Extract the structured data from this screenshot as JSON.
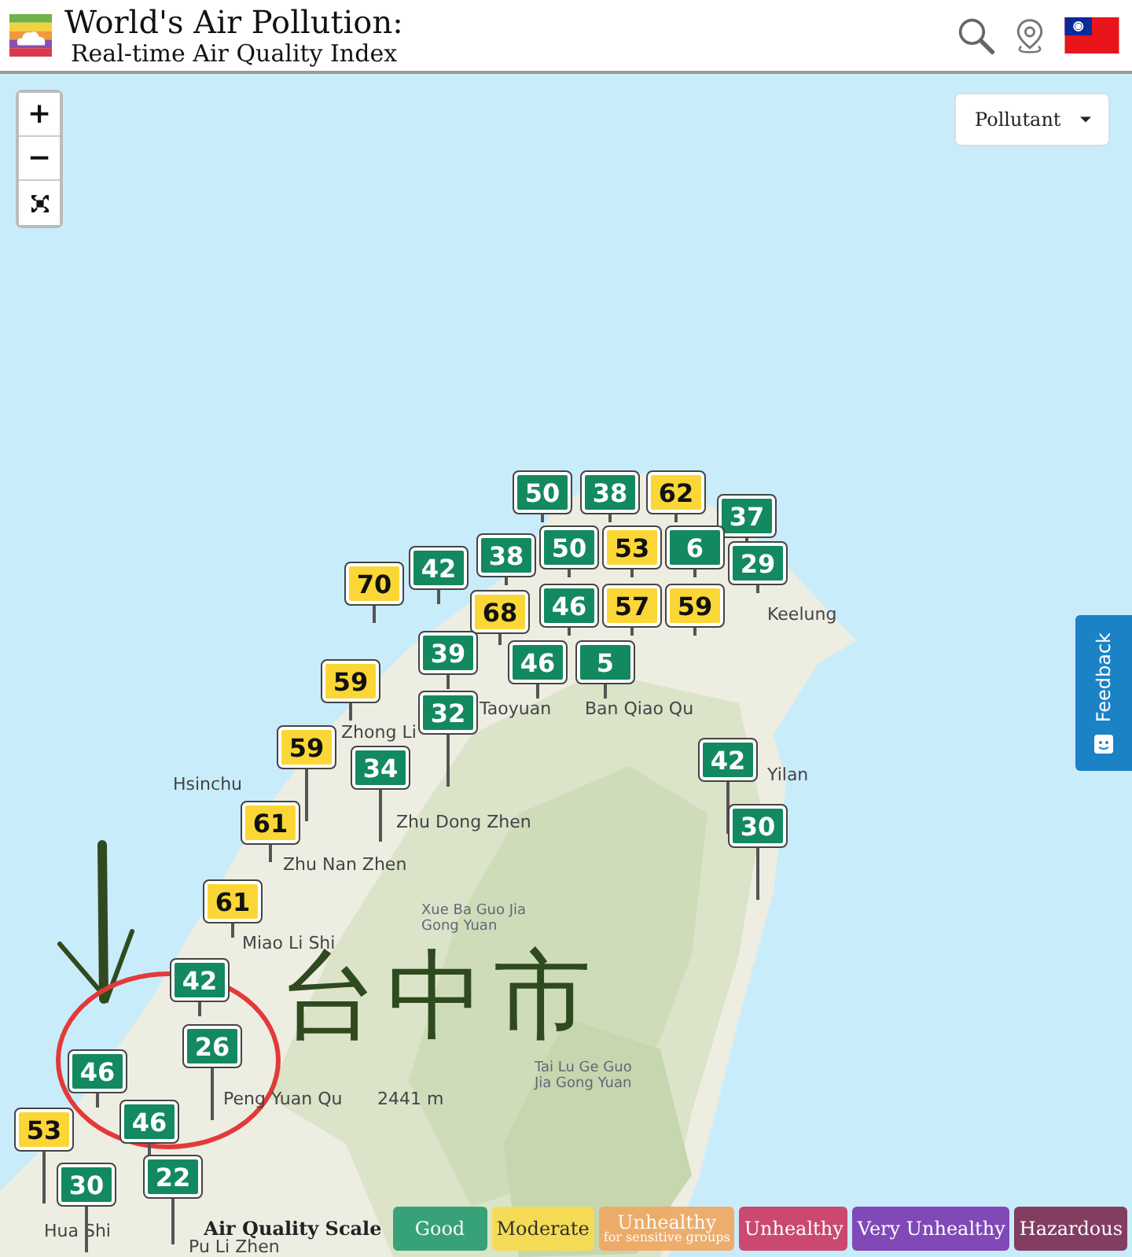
{
  "header": {
    "title": "World's Air Pollution:",
    "subtitle": "Real-time Air Quality Index"
  },
  "map_controls": {
    "zoom_in": "+",
    "zoom_out": "−"
  },
  "pollutant_dropdown": {
    "label": "Pollutant"
  },
  "feedback_tab": {
    "label": "Feedback"
  },
  "markers": [
    {
      "value": "50",
      "kind": "good"
    },
    {
      "value": "38",
      "kind": "good"
    },
    {
      "value": "62",
      "kind": "moderate"
    },
    {
      "value": "37",
      "kind": "good"
    },
    {
      "value": "42",
      "kind": "good"
    },
    {
      "value": "38",
      "kind": "good"
    },
    {
      "value": "50",
      "kind": "good"
    },
    {
      "value": "53",
      "kind": "moderate"
    },
    {
      "value": "6",
      "kind": "good"
    },
    {
      "value": "29",
      "kind": "good"
    },
    {
      "value": "70",
      "kind": "moderate"
    },
    {
      "value": "68",
      "kind": "moderate"
    },
    {
      "value": "46",
      "kind": "good"
    },
    {
      "value": "57",
      "kind": "moderate"
    },
    {
      "value": "59",
      "kind": "moderate"
    },
    {
      "value": "39",
      "kind": "good"
    },
    {
      "value": "46",
      "kind": "good"
    },
    {
      "value": "5",
      "kind": "good"
    },
    {
      "value": "59",
      "kind": "moderate"
    },
    {
      "value": "32",
      "kind": "good"
    },
    {
      "value": "59",
      "kind": "moderate"
    },
    {
      "value": "34",
      "kind": "good"
    },
    {
      "value": "61",
      "kind": "moderate"
    },
    {
      "value": "42",
      "kind": "good"
    },
    {
      "value": "30",
      "kind": "good"
    },
    {
      "value": "61",
      "kind": "moderate"
    },
    {
      "value": "42",
      "kind": "good"
    },
    {
      "value": "26",
      "kind": "good"
    },
    {
      "value": "46",
      "kind": "good"
    },
    {
      "value": "46",
      "kind": "good"
    },
    {
      "value": "53",
      "kind": "moderate"
    },
    {
      "value": "22",
      "kind": "good"
    },
    {
      "value": "30",
      "kind": "good"
    }
  ],
  "place_labels": [
    "Keelung",
    "Taoyuan",
    "Ban Qiao Qu",
    "Zhong Li",
    "Hsinchu",
    "Zhu Dong Zhen",
    "Zhu Nan Zhen",
    "Miao Li Shi",
    "Yilan",
    "Xue Ba Guo Jia Gong Yuan",
    "2441 m",
    "Peng Yuan Qu",
    "Tai Lu Ge Guo Jia Gong Yuan",
    "Hua Shi",
    "Pu Li Zhen"
  ],
  "handwritten_note": "台中市",
  "legend": {
    "title": "Air Quality Scale",
    "items": [
      {
        "label": "Good",
        "color": "#2a9d72"
      },
      {
        "label": "Moderate",
        "color": "#f7dc4f"
      },
      {
        "label": "Unhealthy",
        "sublabel": "for sensitive groups",
        "color": "#f0a862"
      },
      {
        "label": "Unhealthy",
        "color": "#cc3b66"
      },
      {
        "label": "Very Unhealthy",
        "color": "#7b3bb3"
      },
      {
        "label": "Hazardous",
        "color": "#7e2f55"
      }
    ]
  }
}
